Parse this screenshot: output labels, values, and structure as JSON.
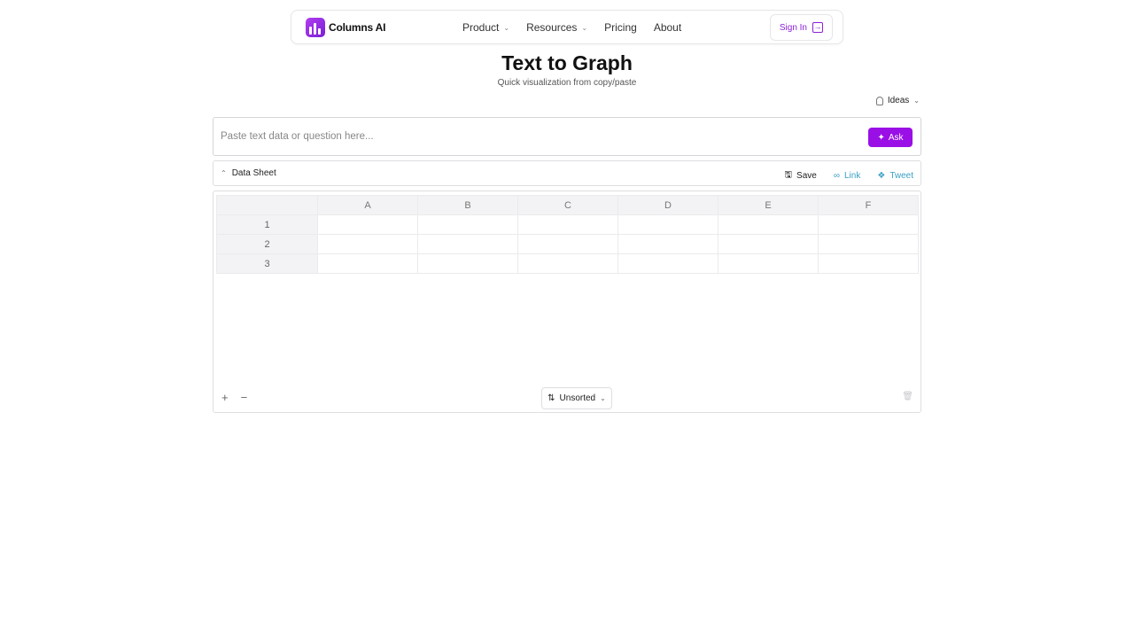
{
  "nav": {
    "logo_text": "Columns AI",
    "items": [
      {
        "label": "Product",
        "has_dropdown": true
      },
      {
        "label": "Resources",
        "has_dropdown": true
      },
      {
        "label": "Pricing",
        "has_dropdown": false
      },
      {
        "label": "About",
        "has_dropdown": false
      }
    ],
    "signin_label": "Sign In"
  },
  "hero": {
    "title": "Text to Graph",
    "subtitle": "Quick visualization from copy/paste"
  },
  "ideas_label": "Ideas",
  "ask": {
    "placeholder": "Paste text data or question here...",
    "value": "",
    "button_label": "Ask"
  },
  "sheet": {
    "label": "Data Sheet",
    "actions": {
      "save": "Save",
      "link": "Link",
      "tweet": "Tweet"
    },
    "columns": [
      "A",
      "B",
      "C",
      "D",
      "E",
      "F"
    ],
    "rows": [
      "1",
      "2",
      "3"
    ],
    "sort_label": "Unsorted",
    "add_symbol": "+",
    "remove_symbol": "−"
  },
  "colors": {
    "accent": "#9a0fe6",
    "link": "#3aa0c4"
  },
  "icons": [
    "columns-logo-icon",
    "chevron-down-icon",
    "sign-in-icon",
    "lightbulb-icon",
    "sparkle-icon",
    "chevron-up-icon",
    "save-icon",
    "link-icon",
    "twitter-icon",
    "sort-icon",
    "plus-icon",
    "minus-icon",
    "trash-icon"
  ]
}
